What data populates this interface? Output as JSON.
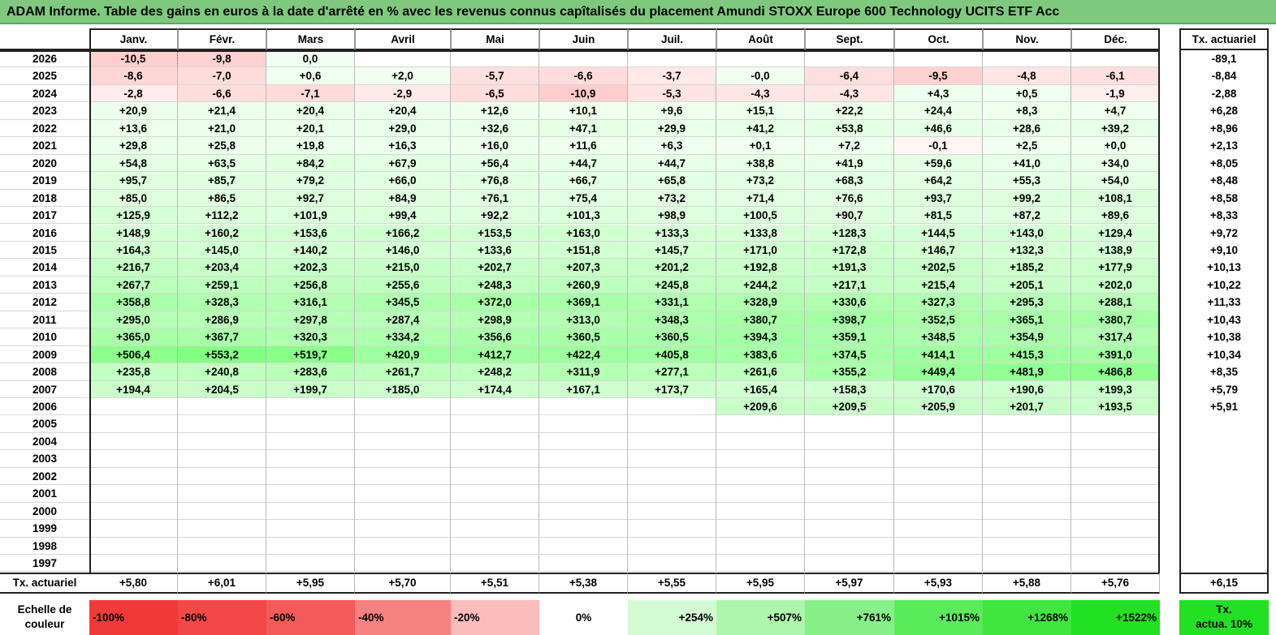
{
  "title": "ADAM Informe. Table des gains en euros à la date d'arrêté en % avec les revenus connus capîtalisés du placement Amundi STOXX Europe 600 Technology UCITS ETF Acc",
  "months": [
    "Janv.",
    "Févr.",
    "Mars",
    "Avril",
    "Mai",
    "Juin",
    "Juil.",
    "Août",
    "Sept.",
    "Oct.",
    "Nov.",
    "Déc."
  ],
  "actuarial_header": "Tx. actuariel",
  "rows": [
    {
      "year": "2026",
      "values": [
        "-10,5",
        "-9,8",
        "0,0",
        "",
        "",
        "",
        "",
        "",
        "",
        "",
        "",
        ""
      ],
      "tx": "-89,1"
    },
    {
      "year": "2025",
      "values": [
        "-8,6",
        "-7,0",
        "+0,6",
        "+2,0",
        "-5,7",
        "-6,6",
        "-3,7",
        "-0,0",
        "-6,4",
        "-9,5",
        "-4,8",
        "-6,1"
      ],
      "tx": "-8,84"
    },
    {
      "year": "2024",
      "values": [
        "-2,8",
        "-6,6",
        "-7,1",
        "-2,9",
        "-6,5",
        "-10,9",
        "-5,3",
        "-4,3",
        "-4,3",
        "+4,3",
        "+0,5",
        "-1,9"
      ],
      "tx": "-2,88"
    },
    {
      "year": "2023",
      "values": [
        "+20,9",
        "+21,4",
        "+20,4",
        "+20,4",
        "+12,6",
        "+10,1",
        "+9,6",
        "+15,1",
        "+22,2",
        "+24,4",
        "+8,3",
        "+4,7"
      ],
      "tx": "+6,28"
    },
    {
      "year": "2022",
      "values": [
        "+13,6",
        "+21,0",
        "+20,1",
        "+29,0",
        "+32,6",
        "+47,1",
        "+29,9",
        "+41,2",
        "+53,8",
        "+46,6",
        "+28,6",
        "+39,2"
      ],
      "tx": "+8,96"
    },
    {
      "year": "2021",
      "values": [
        "+29,8",
        "+25,8",
        "+19,8",
        "+16,3",
        "+16,0",
        "+11,6",
        "+6,3",
        "+0,1",
        "+7,2",
        "-0,1",
        "+2,5",
        "+0,0"
      ],
      "tx": "+2,13"
    },
    {
      "year": "2020",
      "values": [
        "+54,8",
        "+63,5",
        "+84,2",
        "+67,9",
        "+56,4",
        "+44,7",
        "+44,7",
        "+38,8",
        "+41,9",
        "+59,6",
        "+41,0",
        "+34,0"
      ],
      "tx": "+8,05"
    },
    {
      "year": "2019",
      "values": [
        "+95,7",
        "+85,7",
        "+79,2",
        "+66,0",
        "+76,8",
        "+66,7",
        "+65,8",
        "+73,2",
        "+68,3",
        "+64,2",
        "+55,3",
        "+54,0"
      ],
      "tx": "+8,48"
    },
    {
      "year": "2018",
      "values": [
        "+85,0",
        "+86,5",
        "+92,7",
        "+84,9",
        "+76,1",
        "+75,4",
        "+73,2",
        "+71,4",
        "+76,6",
        "+93,7",
        "+99,2",
        "+108,1"
      ],
      "tx": "+8,58"
    },
    {
      "year": "2017",
      "values": [
        "+125,9",
        "+112,2",
        "+101,9",
        "+99,4",
        "+92,2",
        "+101,3",
        "+98,9",
        "+100,5",
        "+90,7",
        "+81,5",
        "+87,2",
        "+89,6"
      ],
      "tx": "+8,33"
    },
    {
      "year": "2016",
      "values": [
        "+148,9",
        "+160,2",
        "+153,6",
        "+166,2",
        "+153,5",
        "+163,0",
        "+133,3",
        "+133,8",
        "+128,3",
        "+144,5",
        "+143,0",
        "+129,4"
      ],
      "tx": "+9,72"
    },
    {
      "year": "2015",
      "values": [
        "+164,3",
        "+145,0",
        "+140,2",
        "+146,0",
        "+133,6",
        "+151,8",
        "+145,7",
        "+171,0",
        "+172,8",
        "+146,7",
        "+132,3",
        "+138,9"
      ],
      "tx": "+9,10"
    },
    {
      "year": "2014",
      "values": [
        "+216,7",
        "+203,4",
        "+202,3",
        "+215,0",
        "+202,7",
        "+207,3",
        "+201,2",
        "+192,8",
        "+191,3",
        "+202,5",
        "+185,2",
        "+177,9"
      ],
      "tx": "+10,13"
    },
    {
      "year": "2013",
      "values": [
        "+267,7",
        "+259,1",
        "+256,8",
        "+255,6",
        "+248,3",
        "+260,9",
        "+245,8",
        "+244,2",
        "+217,1",
        "+215,4",
        "+205,1",
        "+202,0"
      ],
      "tx": "+10,22"
    },
    {
      "year": "2012",
      "values": [
        "+358,8",
        "+328,3",
        "+316,1",
        "+345,5",
        "+372,0",
        "+369,1",
        "+331,1",
        "+328,9",
        "+330,6",
        "+327,3",
        "+295,3",
        "+288,1"
      ],
      "tx": "+11,33"
    },
    {
      "year": "2011",
      "values": [
        "+295,0",
        "+286,9",
        "+297,8",
        "+287,4",
        "+298,9",
        "+313,0",
        "+348,3",
        "+380,7",
        "+398,7",
        "+352,5",
        "+365,1",
        "+380,7"
      ],
      "tx": "+10,43"
    },
    {
      "year": "2010",
      "values": [
        "+365,0",
        "+367,7",
        "+320,3",
        "+334,2",
        "+356,6",
        "+360,5",
        "+360,5",
        "+394,3",
        "+359,1",
        "+348,5",
        "+354,9",
        "+317,4"
      ],
      "tx": "+10,38"
    },
    {
      "year": "2009",
      "values": [
        "+506,4",
        "+553,2",
        "+519,7",
        "+420,9",
        "+412,7",
        "+422,4",
        "+405,8",
        "+383,6",
        "+374,5",
        "+414,1",
        "+415,3",
        "+391,0"
      ],
      "tx": "+10,34"
    },
    {
      "year": "2008",
      "values": [
        "+235,8",
        "+240,8",
        "+283,6",
        "+261,7",
        "+248,2",
        "+311,9",
        "+277,1",
        "+261,6",
        "+355,2",
        "+449,4",
        "+481,9",
        "+486,8"
      ],
      "tx": "+8,35"
    },
    {
      "year": "2007",
      "values": [
        "+194,4",
        "+204,5",
        "+199,7",
        "+185,0",
        "+174,4",
        "+167,1",
        "+173,7",
        "+165,4",
        "+158,3",
        "+170,6",
        "+190,6",
        "+199,3"
      ],
      "tx": "+5,79"
    },
    {
      "year": "2006",
      "values": [
        "",
        "",
        "",
        "",
        "",
        "",
        "",
        "+209,6",
        "+209,5",
        "+205,9",
        "+201,7",
        "+193,5"
      ],
      "tx": "+5,91"
    },
    {
      "year": "2005",
      "values": [
        "",
        "",
        "",
        "",
        "",
        "",
        "",
        "",
        "",
        "",
        "",
        ""
      ],
      "tx": ""
    },
    {
      "year": "2004",
      "values": [
        "",
        "",
        "",
        "",
        "",
        "",
        "",
        "",
        "",
        "",
        "",
        ""
      ],
      "tx": ""
    },
    {
      "year": "2003",
      "values": [
        "",
        "",
        "",
        "",
        "",
        "",
        "",
        "",
        "",
        "",
        "",
        ""
      ],
      "tx": ""
    },
    {
      "year": "2002",
      "values": [
        "",
        "",
        "",
        "",
        "",
        "",
        "",
        "",
        "",
        "",
        "",
        ""
      ],
      "tx": ""
    },
    {
      "year": "2001",
      "values": [
        "",
        "",
        "",
        "",
        "",
        "",
        "",
        "",
        "",
        "",
        "",
        ""
      ],
      "tx": ""
    },
    {
      "year": "2000",
      "values": [
        "",
        "",
        "",
        "",
        "",
        "",
        "",
        "",
        "",
        "",
        "",
        ""
      ],
      "tx": ""
    },
    {
      "year": "1999",
      "values": [
        "",
        "",
        "",
        "",
        "",
        "",
        "",
        "",
        "",
        "",
        "",
        ""
      ],
      "tx": ""
    },
    {
      "year": "1998",
      "values": [
        "",
        "",
        "",
        "",
        "",
        "",
        "",
        "",
        "",
        "",
        "",
        ""
      ],
      "tx": ""
    },
    {
      "year": "1997",
      "values": [
        "",
        "",
        "",
        "",
        "",
        "",
        "",
        "",
        "",
        "",
        "",
        ""
      ],
      "tx": ""
    }
  ],
  "footer": {
    "label": "Tx. actuariel",
    "values": [
      "+5,80",
      "+6,01",
      "+5,95",
      "+5,70",
      "+5,51",
      "+5,38",
      "+5,55",
      "+5,95",
      "+5,97",
      "+5,93",
      "+5,88",
      "+5,76"
    ],
    "total": "+6,15"
  },
  "scale": {
    "label_line1": "Echelle de",
    "label_line2": "couleur",
    "items": [
      {
        "text": "-100%",
        "color": "#f03a3a"
      },
      {
        "text": "-80%",
        "color": "#f24848"
      },
      {
        "text": "-60%",
        "color": "#f45a5a"
      },
      {
        "text": "-40%",
        "color": "#f78080"
      },
      {
        "text": "-20%",
        "color": "#fbbcbc"
      },
      {
        "text": "0%",
        "color": "#ffffff"
      },
      {
        "text": "+254%",
        "color": "#d4fad4"
      },
      {
        "text": "+507%",
        "color": "#aef5ae"
      },
      {
        "text": "+761%",
        "color": "#88f088"
      },
      {
        "text": "+1015%",
        "color": "#5aeb5a"
      },
      {
        "text": "+1268%",
        "color": "#3ee63e"
      },
      {
        "text": "+1522%",
        "color": "#22e022"
      }
    ],
    "actua_line1": "Tx.",
    "actua_line2": "actua. 10%",
    "actua_color": "#22e022"
  },
  "colors": {
    "title_bg": "#7ec97e"
  }
}
